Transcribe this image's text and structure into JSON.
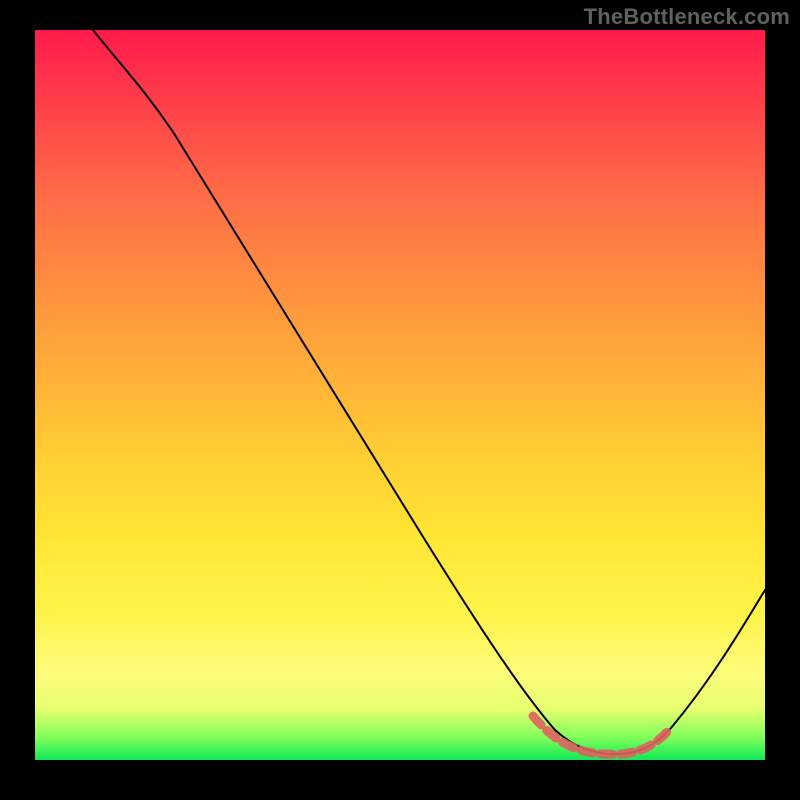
{
  "watermark": "TheBottleneck.com",
  "colors": {
    "background": "#000000",
    "watermark_text": "#606060",
    "curve_stroke": "#000000",
    "valley_marker_stroke": "#e0615f",
    "gradient_top": "#ff1a4b",
    "gradient_bottom": "#10e858"
  },
  "chart_data": {
    "type": "line",
    "title": "",
    "xlabel": "",
    "ylabel": "",
    "xlim": [
      0,
      100
    ],
    "ylim": [
      0,
      100
    ],
    "x": [
      8,
      15,
      25,
      35,
      45,
      55,
      63,
      68,
      72,
      76,
      80,
      84,
      90,
      95,
      100
    ],
    "values": [
      100,
      95,
      81,
      66,
      51,
      36,
      23,
      13,
      6,
      2,
      1,
      2,
      10,
      22,
      35
    ],
    "annotations": [
      {
        "name": "optimal-range",
        "x_start": 68,
        "x_end": 86,
        "note": "valley marked with dashed red segment near bottom"
      }
    ]
  }
}
